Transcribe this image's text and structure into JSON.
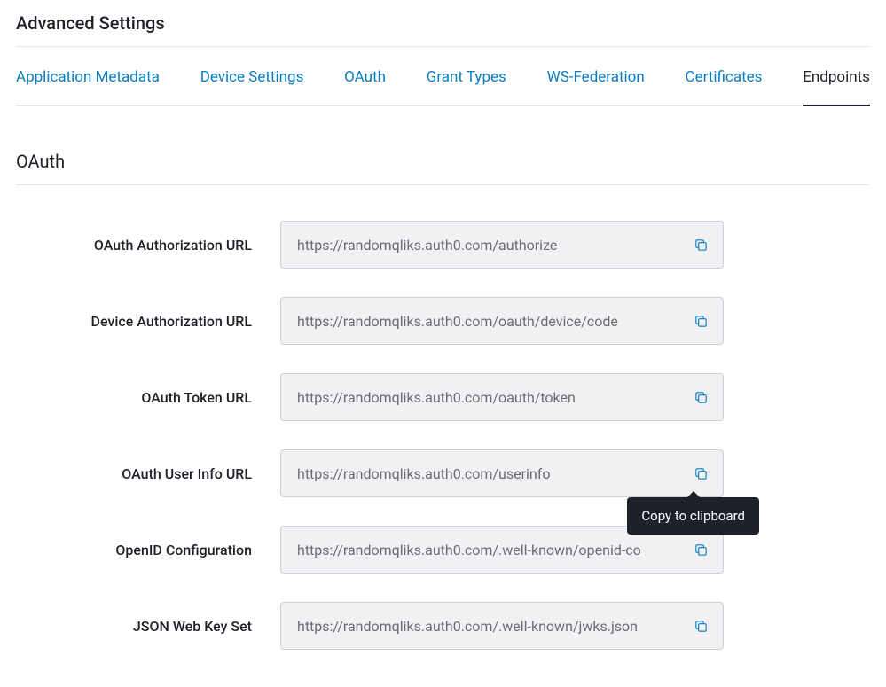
{
  "header": {
    "title": "Advanced Settings"
  },
  "tabs": [
    {
      "label": "Application Metadata",
      "active": false
    },
    {
      "label": "Device Settings",
      "active": false
    },
    {
      "label": "OAuth",
      "active": false
    },
    {
      "label": "Grant Types",
      "active": false
    },
    {
      "label": "WS-Federation",
      "active": false
    },
    {
      "label": "Certificates",
      "active": false
    },
    {
      "label": "Endpoints",
      "active": true
    }
  ],
  "subsection": {
    "title": "OAuth"
  },
  "tooltip": {
    "copy": "Copy to clipboard"
  },
  "fields": [
    {
      "label": "OAuth Authorization URL",
      "value": "https://randomqliks.auth0.com/authorize",
      "showTooltip": false
    },
    {
      "label": "Device Authorization URL",
      "value": "https://randomqliks.auth0.com/oauth/device/code",
      "showTooltip": false
    },
    {
      "label": "OAuth Token URL",
      "value": "https://randomqliks.auth0.com/oauth/token",
      "showTooltip": false
    },
    {
      "label": "OAuth User Info URL",
      "value": "https://randomqliks.auth0.com/userinfo",
      "showTooltip": true
    },
    {
      "label": "OpenID Configuration",
      "value": "https://randomqliks.auth0.com/.well-known/openid-co",
      "showTooltip": false
    },
    {
      "label": "JSON Web Key Set",
      "value": "https://randomqliks.auth0.com/.well-known/jwks.json",
      "showTooltip": false
    }
  ]
}
